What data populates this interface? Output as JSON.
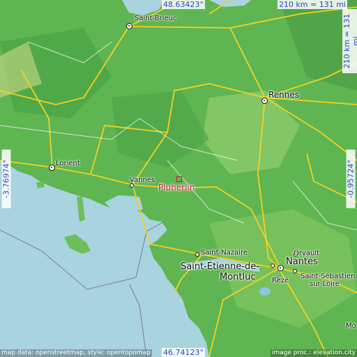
{
  "place": {
    "name": "Pluherlin",
    "color": "#d1143c"
  },
  "coordinates": {
    "top": "48.63423°",
    "bottom": "46.74123°",
    "left": "-3.76974°",
    "right": "-0.95724°"
  },
  "scale": {
    "horizontal": "210 km = 131 mi",
    "vertical": "210 km = 131 mi"
  },
  "cities": {
    "saint_brieuc": "Saint-Brieuc",
    "rennes": "Rennes",
    "lorient": "Lorient",
    "vannes": "Vannes",
    "saint_nazaire": "Saint-Nazaire",
    "saint_etienne_l1": "Saint-Étienne-de-",
    "saint_etienne_l2": "Montluc",
    "orvault": "Orvault",
    "nantes": "Nantes",
    "reze": "Rezé",
    "saint_sebastien_l1": "Saint-Sébastien-",
    "saint_sebastien_l2": "sur-Loire",
    "partial_right": "Mo"
  },
  "attribution": {
    "left": "map data: openstreetmap, style: opentopomap",
    "right": "image proc.: elevation.city"
  },
  "colors": {
    "sea": "#a9d3df",
    "land_green": "#6cbf5a",
    "land_light": "#9ed07c",
    "land_dark": "#3f9a3b",
    "roads": "#f2d21e",
    "coord_text": "#2a47c8"
  }
}
